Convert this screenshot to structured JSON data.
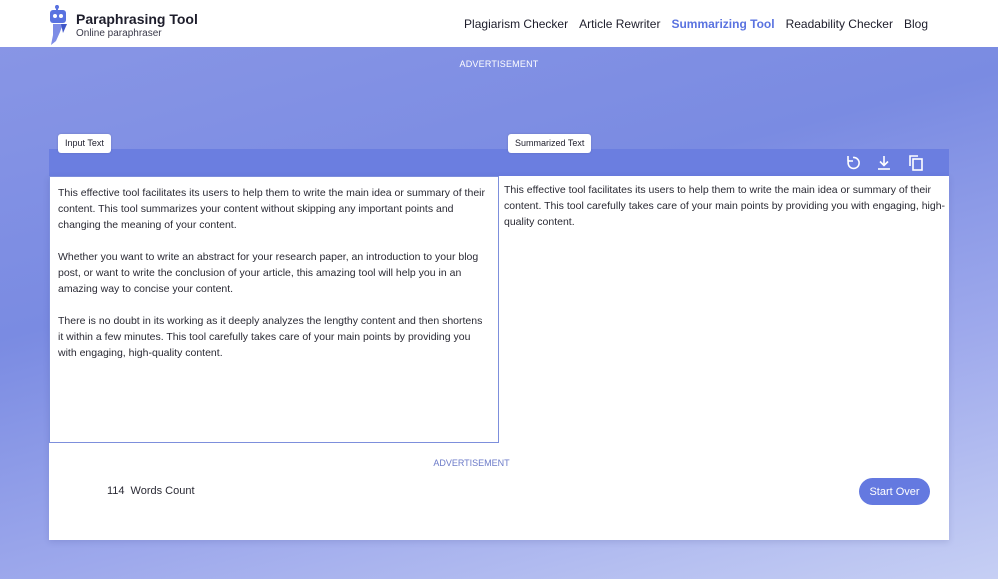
{
  "header": {
    "brand_title": "Paraphrasing Tool",
    "brand_subtitle": "Online paraphraser",
    "nav": [
      {
        "label": "Plagiarism Checker",
        "active": false
      },
      {
        "label": "Article Rewriter",
        "active": false
      },
      {
        "label": "Summarizing Tool",
        "active": true
      },
      {
        "label": "Readability Checker",
        "active": false
      },
      {
        "label": "Blog",
        "active": false
      }
    ]
  },
  "ads": {
    "top": "ADVERTISEMENT",
    "middle": "ADVERTISEMENT"
  },
  "input": {
    "label": "Input Text",
    "paragraphs": [
      "This effective tool facilitates its users to help them to write the main idea or summary of their content. This tool summarizes your content without skipping any important points and changing the meaning of your content.",
      "Whether you want to write an abstract for your research paper, an introduction to your blog post, or want to write the conclusion of your article, this amazing tool will help you in an amazing way to concise your content.",
      "There is no doubt in its working as it deeply analyzes the lengthy content and then shortens it within a few minutes. This tool carefully takes care of your main points by providing you with engaging, high-quality content."
    ]
  },
  "output": {
    "label": "Summarized Text",
    "text": "This effective tool facilitates its users to help them to write the main idea or summary of their content. This tool carefully takes care of your main points by providing you with engaging, high-quality content."
  },
  "toolbar": {
    "icons": [
      "reload-icon",
      "download-icon",
      "copy-icon"
    ]
  },
  "footer": {
    "word_count": "114",
    "word_count_label": "Words Count",
    "start_over": "Start Over"
  },
  "colors": {
    "accent": "#5a73e0",
    "toolbar": "#6b7ee0",
    "button": "#6479e0"
  }
}
